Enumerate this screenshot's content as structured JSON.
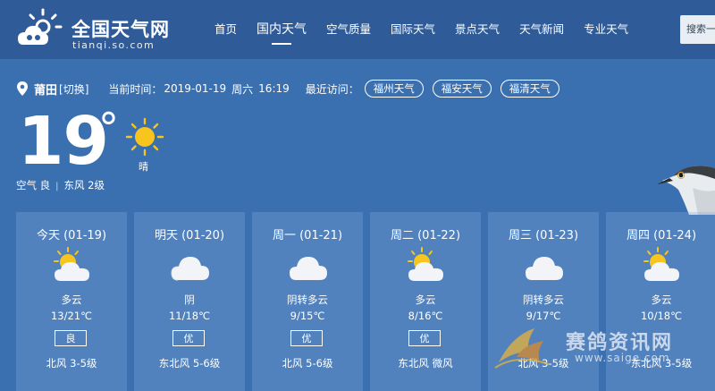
{
  "header": {
    "logo_title": "全国天气网",
    "logo_subtitle": "tianqi.so.com",
    "nav": [
      "首页",
      "国内天气",
      "空气质量",
      "国际天气",
      "景点天气",
      "天气新闻",
      "专业天气"
    ],
    "active_nav": "国内天气",
    "search_label": "搜索一"
  },
  "location": {
    "city": "莆田",
    "switch_label": "[切换]",
    "time_label": "当前时间：",
    "date": "2019-01-19",
    "weekday": "周六",
    "time": "16:19",
    "recent_label": "最近访问：",
    "recent": [
      "福州天气",
      "福安天气",
      "福清天气"
    ]
  },
  "current": {
    "temperature": "19",
    "degree_symbol": "°",
    "condition": "晴",
    "air": "空气 良",
    "separator": "|",
    "wind": "东风 2级",
    "icon": "sun-icon"
  },
  "forecast": [
    {
      "date": "今天 (01-19)",
      "icon": "partly-cloudy-icon",
      "condition": "多云",
      "temp": "13/21℃",
      "aqi": "良",
      "wind": "北风 3-5级"
    },
    {
      "date": "明天 (01-20)",
      "icon": "cloudy-icon",
      "condition": "阴",
      "temp": "11/18℃",
      "aqi": "优",
      "wind": "东北风 5-6级"
    },
    {
      "date": "周一 (01-21)",
      "icon": "cloudy-icon",
      "condition": "阴转多云",
      "temp": "9/15℃",
      "aqi": "优",
      "wind": "北风 5-6级"
    },
    {
      "date": "周二 (01-22)",
      "icon": "partly-cloudy-icon",
      "condition": "多云",
      "temp": "8/16℃",
      "aqi": "优",
      "wind": "东北风 微风"
    },
    {
      "date": "周三 (01-23)",
      "icon": "cloudy-icon",
      "condition": "阴转多云",
      "temp": "9/17℃",
      "aqi": "",
      "wind": "北风 3-5级"
    },
    {
      "date": "周四 (01-24)",
      "icon": "partly-cloudy-icon",
      "condition": "多云",
      "temp": "10/18℃",
      "aqi": "",
      "wind": "东北风 3-5级"
    }
  ],
  "watermark": {
    "text": "赛鸽资讯网",
    "url": "www.saige.com"
  },
  "colors": {
    "background": "#3a6fb0",
    "topbar": "#2f5c98",
    "sun": "#f7c51e",
    "cloud": "#f2f4f7"
  }
}
